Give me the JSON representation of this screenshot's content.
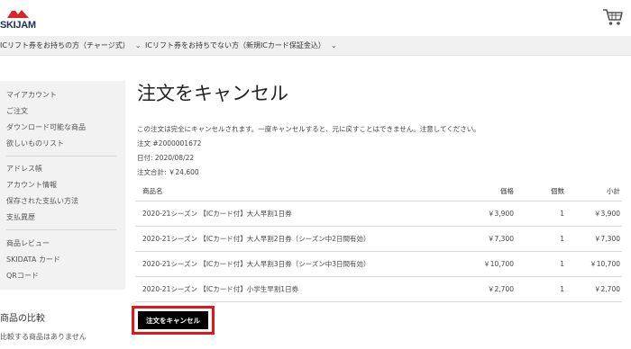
{
  "header": {
    "logo_text": "SKIJAM",
    "brand_color": "#1c2d5a",
    "accent_color": "#d9232d",
    "cart_icon": "cart-icon"
  },
  "nav": {
    "items": [
      {
        "label": "ICリフト券をお持ちの方（チャージ式）"
      },
      {
        "label": "ICリフト券をお持ちでない方（新規ICカード保証金込）"
      }
    ]
  },
  "sidebar": {
    "groups": [
      [
        "マイアカウント",
        "ご注文",
        "ダウンロード可能な商品",
        "欲しいものリスト"
      ],
      [
        "アドレス帳",
        "アカウント情報",
        "保存された支払い方法",
        "支払異歴"
      ],
      [
        "商品レビュー",
        "SKIDATA カード",
        "QRコード"
      ]
    ]
  },
  "compare": {
    "title": "商品の比較",
    "empty": "比較する商品はありません"
  },
  "main": {
    "title": "注文をキャンセル",
    "notice": "この注文は完全にキャンセルされます。一度キャンセルすると、元に戻すことはできません。注意してください。",
    "order_no": "注文 #2000001672",
    "date": "日付: 2020/08/22",
    "total": "注文合計: ￥24,600"
  },
  "table": {
    "headers": {
      "name": "商品名",
      "price": "価格",
      "qty": "個数",
      "subtotal": "小計"
    },
    "rows": [
      {
        "name": "2020-21シーズン 【ICカード付】大人早割1日券",
        "price": "￥3,900",
        "qty": "1",
        "subtotal": "￥3,900"
      },
      {
        "name": "2020-21シーズン 【ICカード付】大人早割2日券（シーズン中2日間有効）",
        "price": "￥7,300",
        "qty": "1",
        "subtotal": "￥7,300"
      },
      {
        "name": "2020-21シーズン 【ICカード付】大人早割3日券（シーズン中3日間有効）",
        "price": "￥10,700",
        "qty": "1",
        "subtotal": "￥10,700"
      },
      {
        "name": "2020-21シーズン 【ICカード付】小学生早割1日券",
        "price": "￥2,700",
        "qty": "1",
        "subtotal": "￥2,700"
      }
    ]
  },
  "actions": {
    "cancel_label": "注文をキャンセル",
    "highlight_color": "#e01818"
  }
}
